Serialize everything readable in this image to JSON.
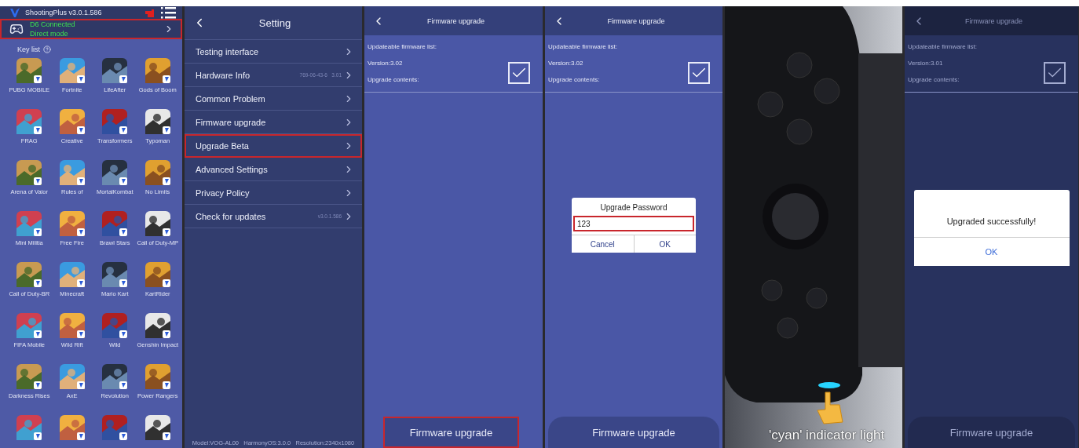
{
  "panels": [
    {
      "kind": "home",
      "app_title": "ShootingPlus v3.0.1.586",
      "connection": {
        "status": "D6 Connected",
        "mode": "Direct mode",
        "highlighted": true
      },
      "key_list_label": "Key list",
      "games": [
        {
          "kind": "app",
          "label": "PUBG MOBILE"
        },
        {
          "kind": "app",
          "label": "Fortnite"
        },
        {
          "kind": "app",
          "label": "LifeAfter"
        },
        {
          "kind": "app",
          "label": "Gods of Boom"
        },
        {
          "kind": "app",
          "label": "FRAG"
        },
        {
          "kind": "app",
          "label": "Creative"
        },
        {
          "kind": "app",
          "label": "Transformers"
        },
        {
          "kind": "app",
          "label": "Typoman"
        },
        {
          "kind": "app",
          "label": "Arena of Valor"
        },
        {
          "kind": "app",
          "label": "Rules of"
        },
        {
          "kind": "app",
          "label": "MortalKombat"
        },
        {
          "kind": "app",
          "label": "No Limits"
        },
        {
          "kind": "app",
          "label": "Mini Militia"
        },
        {
          "kind": "app",
          "label": "Free Fire"
        },
        {
          "kind": "app",
          "label": "Brawl Stars"
        },
        {
          "kind": "app",
          "label": "Call of Duty-MP"
        },
        {
          "kind": "app",
          "label": "Call of Duty-BR"
        },
        {
          "kind": "app",
          "label": "Minecraft"
        },
        {
          "kind": "app",
          "label": "Mario Kart"
        },
        {
          "kind": "app",
          "label": "KartRider"
        },
        {
          "kind": "app",
          "label": "FIFA Mobile"
        },
        {
          "kind": "app",
          "label": "Wild Rift"
        },
        {
          "kind": "app",
          "label": "Wild"
        },
        {
          "kind": "app",
          "label": "Genshin Impact"
        },
        {
          "kind": "app",
          "label": "Darkness Rises"
        },
        {
          "kind": "app",
          "label": "AxE"
        },
        {
          "kind": "app",
          "label": "Revolution"
        },
        {
          "kind": "app",
          "label": "Power Rangers"
        },
        {
          "kind": "picture"
        },
        {
          "kind": "picture"
        },
        {
          "kind": "picture"
        },
        {
          "kind": "picture"
        }
      ]
    },
    {
      "kind": "settings",
      "title": "Setting",
      "rows": [
        {
          "label": "Testing interface",
          "highlighted": false
        },
        {
          "label": "Hardware Info",
          "value": "769-06-43-6   3.01",
          "highlighted": false
        },
        {
          "label": "Common Problem",
          "highlighted": false
        },
        {
          "label": "Firmware upgrade",
          "highlighted": false
        },
        {
          "label": "Upgrade Beta",
          "highlighted": true
        },
        {
          "label": "Advanced Settings",
          "highlighted": false
        },
        {
          "label": "Privacy Policy",
          "highlighted": false
        },
        {
          "label": "Check for updates",
          "value": "v3.0.1.586",
          "highlighted": false
        }
      ],
      "footer": "Model:VOG-AL00   HarmonyOS:3.0.0   Resolution:2340x1080"
    },
    {
      "kind": "firmware",
      "title": "Firmware upgrade",
      "list_label": "Updateable firmware list:",
      "version": "Version:3.02",
      "contents_label": "Upgrade contents:",
      "checked": true,
      "dimmed": false,
      "button": {
        "label": "Firmware upgrade",
        "highlighted": true
      }
    },
    {
      "kind": "firmware",
      "title": "Firmware upgrade",
      "list_label": "Updateable firmware list:",
      "version": "Version:3.02",
      "contents_label": "Upgrade contents:",
      "checked": true,
      "dimmed": false,
      "button": {
        "label": "Firmware upgrade",
        "highlighted": false
      },
      "dialog": {
        "kind": "password",
        "title": "Upgrade Password",
        "value": "123",
        "highlighted": true,
        "buttons": [
          "Cancel",
          "OK"
        ]
      }
    },
    {
      "caption": "'cyan' indicator light"
    },
    {
      "kind": "firmware",
      "title": "Firmware upgrade",
      "list_label": "Updateable firmware list:",
      "version": "Version:3.01",
      "contents_label": "Upgrade contents:",
      "checked": true,
      "dimmed": true,
      "button": {
        "label": "Firmware upgrade",
        "highlighted": false
      },
      "dialog": {
        "kind": "message",
        "message": "Upgraded successfully!",
        "buttons": [
          "OK"
        ]
      }
    }
  ]
}
